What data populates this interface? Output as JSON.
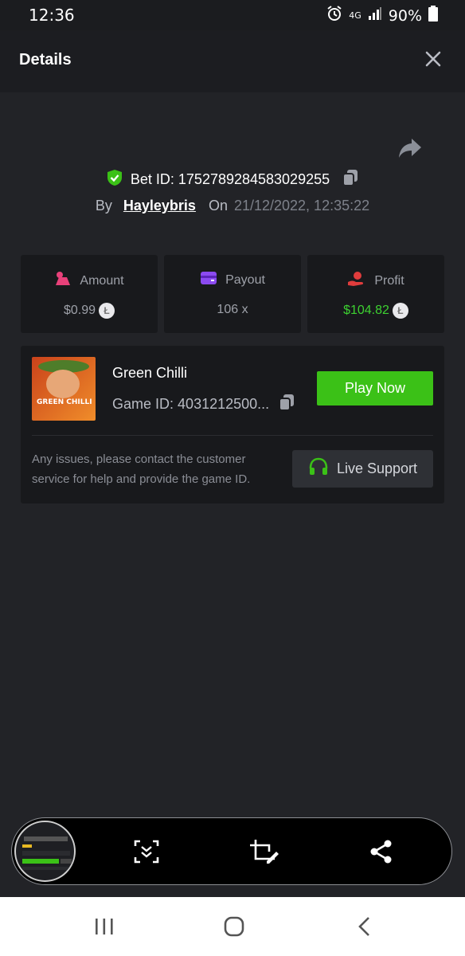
{
  "status_bar": {
    "time": "12:36",
    "network": "4G",
    "battery": "90%",
    "icons": [
      "alarm-icon",
      "signal-icon",
      "battery-icon"
    ]
  },
  "header": {
    "title": "Details",
    "close_icon": "close-icon"
  },
  "bet": {
    "id_label": "Bet ID:",
    "id_value": "1752789284583029255",
    "by_label": "By",
    "username": "Hayleybris",
    "on_label": "On",
    "datetime": "21/12/2022, 12:35:22"
  },
  "stats": {
    "amount": {
      "label": "Amount",
      "value": "$0.99"
    },
    "payout": {
      "label": "Payout",
      "value": "106 x"
    },
    "profit": {
      "label": "Profit",
      "value": "$104.82"
    }
  },
  "game": {
    "title": "Green Chilli",
    "id_label": "Game ID:",
    "id_value": "4031212500...",
    "play_label": "Play Now",
    "thumb_text": "GREEN CHILLI",
    "notice": "Any issues, please contact the customer service for help and provide the game ID.",
    "support_label": "Live Support"
  },
  "colors": {
    "accent_green": "#3bc117",
    "profit_green": "#3dd131",
    "bg": "#222327",
    "card": "#18191c"
  }
}
